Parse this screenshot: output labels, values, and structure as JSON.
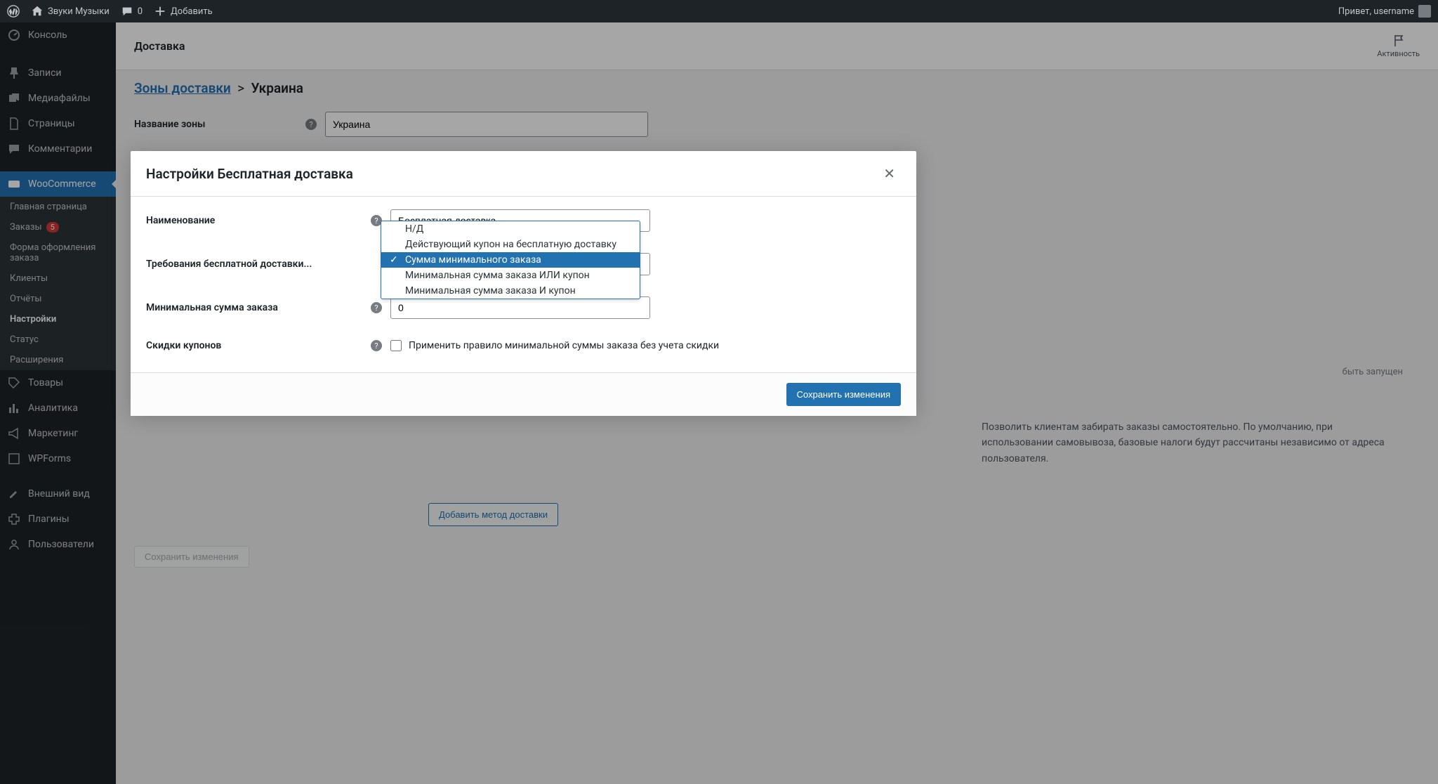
{
  "admin_bar": {
    "site_name": "Звуки Музыки",
    "comments_count": "0",
    "add_new": "Добавить",
    "greeting": "Привет, username"
  },
  "sidebar": {
    "items": [
      {
        "label": "Консоль"
      },
      {
        "label": "Записи"
      },
      {
        "label": "Медиафайлы"
      },
      {
        "label": "Страницы"
      },
      {
        "label": "Комментарии"
      },
      {
        "label": "WooCommerce"
      },
      {
        "label": "Товары"
      },
      {
        "label": "Аналитика"
      },
      {
        "label": "Маркетинг"
      },
      {
        "label": "WPForms"
      },
      {
        "label": "Внешний вид"
      },
      {
        "label": "Плагины"
      },
      {
        "label": "Пользователи"
      }
    ],
    "woo_sub": [
      {
        "label": "Главная страница"
      },
      {
        "label": "Заказы",
        "badge": "5"
      },
      {
        "label": "Форма оформления заказа"
      },
      {
        "label": "Клиенты"
      },
      {
        "label": "Отчёты"
      },
      {
        "label": "Настройки"
      },
      {
        "label": "Статус"
      },
      {
        "label": "Расширения"
      }
    ]
  },
  "header": {
    "title": "Доставка",
    "activity": "Активность"
  },
  "breadcrumb": {
    "zones_link": "Зоны доставки",
    "current": "Украина"
  },
  "zone_form": {
    "label_name": "Название зоны",
    "value_name": "Украина",
    "pickup_hidden_prefix": "быть запущен",
    "pickup_text": "Позволить клиентам забирать заказы самостоятельно. По умолчанию, при использовании самовывоза, базовые налоги будут рассчитаны независимо от адреса пользователя.",
    "add_method": "Добавить метод доставки",
    "save_changes": "Сохранить изменения"
  },
  "modal": {
    "title": "Настройки Бесплатная доставка",
    "label_name": "Наименование",
    "value_name": "Бесплатная доставка",
    "label_requires": "Требования бесплатной доставки...",
    "label_min_amount": "Минимальная сумма заказа",
    "value_min_amount": "0",
    "label_coupon_discount": "Скидки купонов",
    "checkbox_label": "Применить правило минимальной суммы заказа без учета скидки",
    "save": "Сохранить изменения"
  },
  "dropdown": {
    "options": [
      "Н/Д",
      "Действующий купон на бесплатную доставку",
      "Сумма минимального заказа",
      "Минимальная сумма заказа ИЛИ купон",
      "Минимальная сумма заказа И купон"
    ],
    "selected_index": 2
  }
}
